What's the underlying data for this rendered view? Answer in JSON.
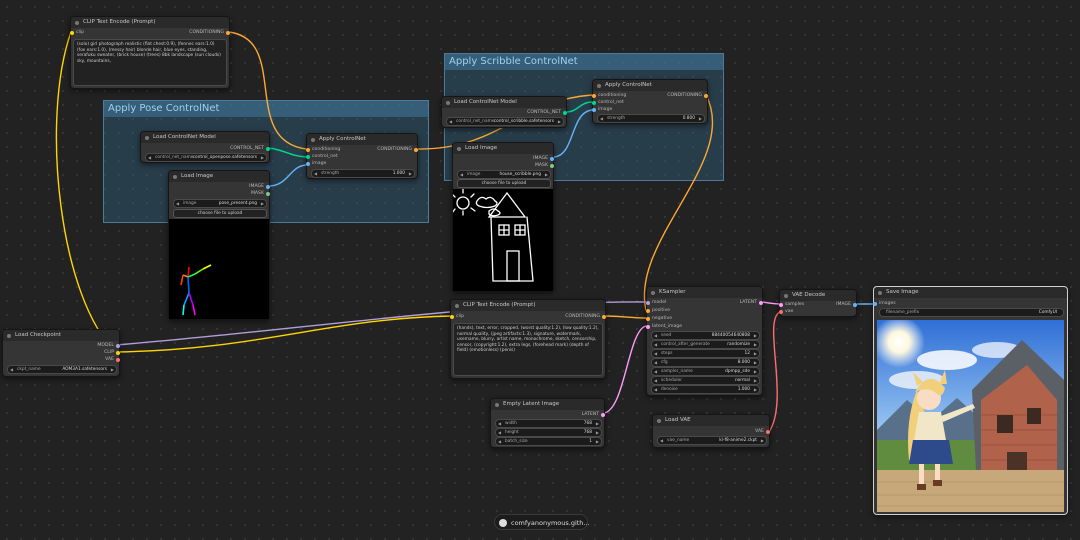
{
  "colors": {
    "clip": "#ffd500",
    "conditioning": "#ffa931",
    "control_net": "#00d78d",
    "image": "#64b5f6",
    "model": "#b39ddb",
    "latent": "#ff9cf9",
    "vae": "#ff6e6e"
  },
  "groups": {
    "scribble": "Apply Scribble ControlNet",
    "pose": "Apply Pose ControlNet"
  },
  "clip_top": {
    "title": "CLIP Text Encode (Prompt)",
    "in_clip": "clip",
    "out_cond": "CONDITIONING",
    "text": "(solo) girl photograph realistic (flat chest:0.9), (fennec ears:1.0) (fox ears:1.0), (messy hair) blonde hair, blue eyes, standing, serafuku sweater, (brick house) (trees) 8bk landscape (sun clouds) sky, mountains,"
  },
  "load_cn_pose": {
    "title": "Load ControlNet Model",
    "out": "CONTROL_NET",
    "w_label": "control_net_name",
    "w_value": "control_openpose.safetensors"
  },
  "load_img_pose": {
    "title": "Load Image",
    "out_image": "IMAGE",
    "out_mask": "MASK",
    "w_label": "image",
    "w_value": "pose_present.png",
    "button": "choose file to upload"
  },
  "apply_cn_pose": {
    "title": "Apply ControlNet",
    "in1": "conditioning",
    "in2": "control_net",
    "in3": "image",
    "out": "CONDITIONING",
    "w_label": "strength",
    "w_value": "1.000"
  },
  "load_cn_scribble": {
    "title": "Load ControlNet Model",
    "out": "CONTROL_NET",
    "w_label": "control_net_name",
    "w_value": "control_scribble.safetensors"
  },
  "load_img_scribble": {
    "title": "Load Image",
    "out_image": "IMAGE",
    "out_mask": "MASK",
    "w_label": "image",
    "w_value": "house_scribble.png",
    "button": "choose file to upload"
  },
  "apply_cn_scribble": {
    "title": "Apply ControlNet",
    "in1": "conditioning",
    "in2": "control_net",
    "in3": "image",
    "out": "CONDITIONING",
    "w_label": "strength",
    "w_value": "0.800"
  },
  "ckpt": {
    "title": "Load Checkpoint",
    "out1": "MODEL",
    "out2": "CLIP",
    "out3": "VAE",
    "w_label": "ckpt_name",
    "w_value": "AOM3A1.safetensors"
  },
  "clip_bottom": {
    "title": "CLIP Text Encode (Prompt)",
    "in_clip": "clip",
    "out_cond": "CONDITIONING",
    "text": "(hands), text, error, cropped, (worst quality:1.2), (low quality:1.2), normal quality, (jpeg artifacts:1.3), signature, watermark, username, blurry, artist name, monochrome, sketch, censorship, censor, (copyright:1.2), extra legs, (forehead mark) (depth of field) (emotionless) (penis)"
  },
  "ksampler": {
    "title": "KSampler",
    "in1": "model",
    "in2": "positive",
    "in3": "negative",
    "in4": "latent_image",
    "out": "LATENT",
    "widgets": [
      {
        "label": "seed",
        "value": "88440054640808"
      },
      {
        "label": "control_after_generate",
        "value": "randomize"
      },
      {
        "label": "steps",
        "value": "12"
      },
      {
        "label": "cfg",
        "value": "8.000"
      },
      {
        "label": "sampler_name",
        "value": "dpmpp_sde"
      },
      {
        "label": "scheduler",
        "value": "normal"
      },
      {
        "label": "denoise",
        "value": "1.000"
      }
    ]
  },
  "empty_latent": {
    "title": "Empty Latent Image",
    "out": "LATENT",
    "widgets": [
      {
        "label": "width",
        "value": "768"
      },
      {
        "label": "height",
        "value": "768"
      },
      {
        "label": "batch_size",
        "value": "1"
      }
    ]
  },
  "load_vae": {
    "title": "Load VAE",
    "out": "VAE",
    "w_label": "vae_name",
    "w_value": "kl-f8-anime2.ckpt"
  },
  "vae_decode": {
    "title": "VAE Decode",
    "in1": "samples",
    "in2": "vae",
    "out": "IMAGE"
  },
  "save_image": {
    "title": "Save Image",
    "in1": "images",
    "w_label": "filename_prefix",
    "w_value": "ComfyUI"
  },
  "footer": {
    "label": "comfyanonymous.gith..."
  }
}
